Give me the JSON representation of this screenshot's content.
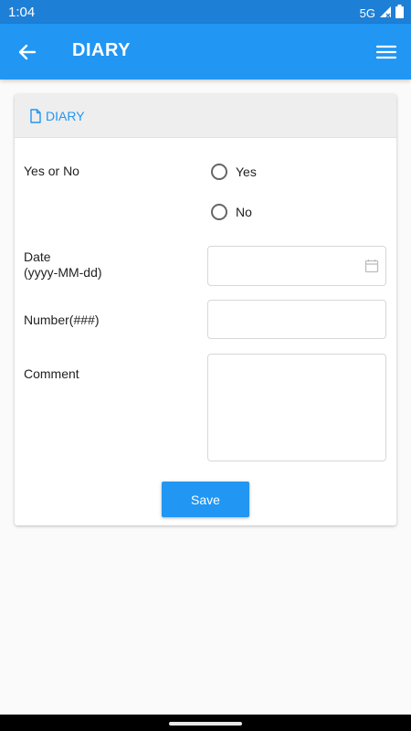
{
  "status_bar": {
    "time": "1:04",
    "network": "5G",
    "icons": [
      "signal-icon",
      "battery-icon"
    ]
  },
  "app_bar": {
    "title": "DIARY",
    "back_icon": "arrow-back-icon",
    "menu_icon": "hamburger-menu-icon"
  },
  "card": {
    "header_icon": "document-icon",
    "header_title": "DIARY"
  },
  "form": {
    "yes_no": {
      "label": "Yes or No",
      "options": [
        "Yes",
        "No"
      ],
      "selected": null
    },
    "date": {
      "label_line1": "Date",
      "label_line2": "(yyyy-MM-dd)",
      "value": "",
      "icon": "calendar-icon"
    },
    "number": {
      "label": "Number(###)",
      "value": ""
    },
    "comment": {
      "label": "Comment",
      "value": ""
    },
    "save_label": "Save"
  },
  "colors": {
    "accent": "#2196f3",
    "status_bar": "#1e7fd6",
    "card_header_bg": "#eeeeee"
  }
}
